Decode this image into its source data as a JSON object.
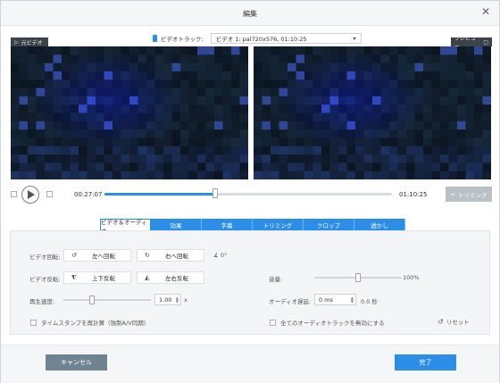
{
  "dialog": {
    "title": "編集"
  },
  "video_track": {
    "label": "ビデオトラック:",
    "value": "ビデオ 1: pal720x576, 01:10:25"
  },
  "panes": {
    "original_label": "元ビデオ",
    "preview_label": "プレビュー"
  },
  "playback": {
    "current_time": "00:27:07",
    "end_time": "01:10:25",
    "progress": 0.385,
    "trim_label": "トリミング"
  },
  "tabs": [
    {
      "label": "ビデオ＆オーディオ",
      "active": true
    },
    {
      "label": "効果"
    },
    {
      "label": "字幕"
    },
    {
      "label": "トリミング"
    },
    {
      "label": "クロップ"
    },
    {
      "label": "透かし"
    }
  ],
  "video_audio": {
    "rotate_label": "ビデオ回転:",
    "rotate_left": "左へ回転",
    "rotate_right": "右へ回転",
    "rotation_value": "0°",
    "flip_label": "ビデオ反転:",
    "flip_vertical": "上下反転",
    "flip_horizontal": "左右反転",
    "speed_label": "再生速度:",
    "speed_value": "1.00",
    "speed_unit": "x",
    "speed_slider": 0.33,
    "timestamp_label": "タイムスタンプを再計算（強制A/V同期）",
    "volume_label": "音量:",
    "volume_value": "100%",
    "volume_slider": 0.5,
    "delay_label": "オーディオ遅延:",
    "delay_value": "0 ms",
    "delay_seconds": "0.0 秒",
    "delay_slider": 0.5,
    "disable_audio_label": "全てのオーディオトラックを無効にする",
    "reset_label": "リセット"
  },
  "footer": {
    "cancel_label": "キャンセル",
    "done_label": "完了"
  },
  "colors": {
    "accent": "#2d8ee8",
    "cancel": "#6f8391",
    "video_bg": "#0f1a24"
  }
}
